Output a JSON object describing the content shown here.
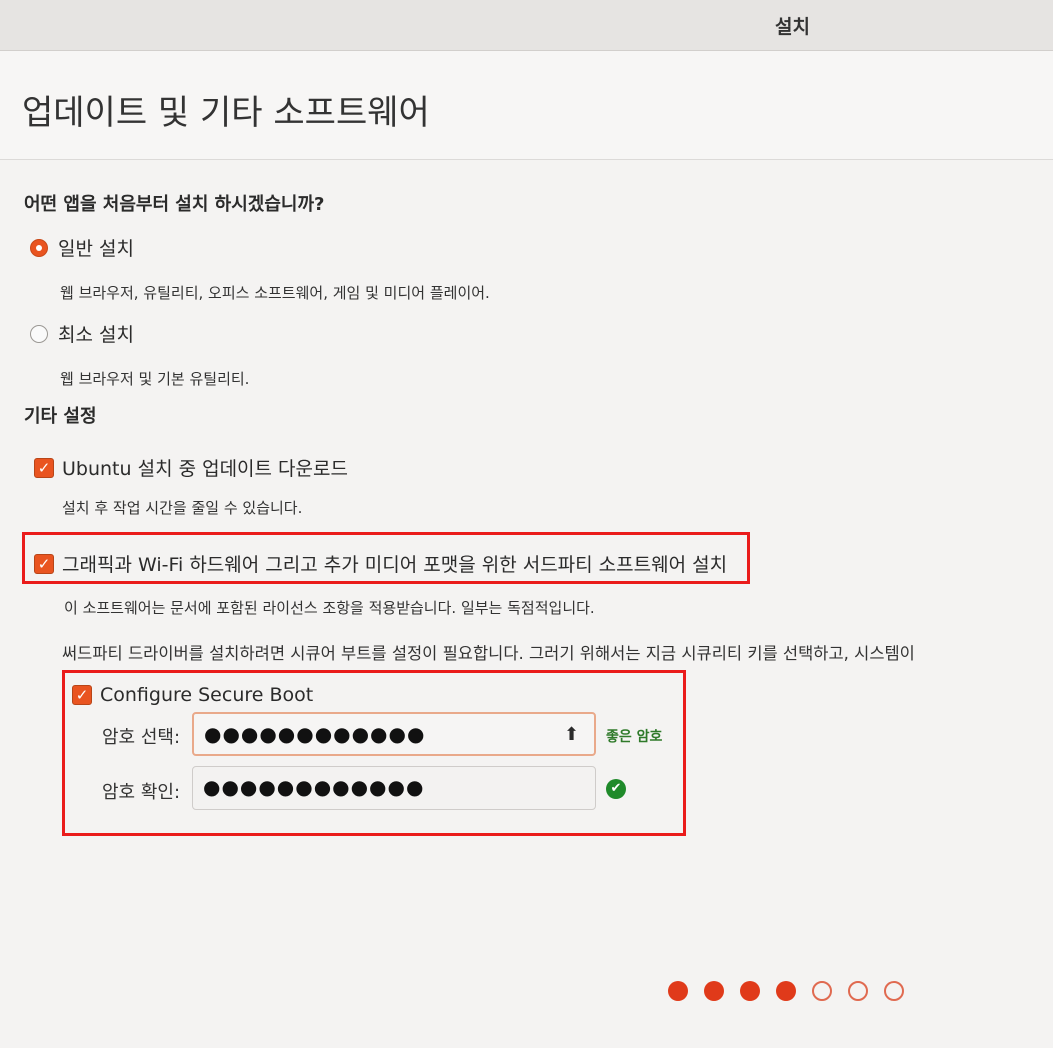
{
  "window": {
    "title": "설치"
  },
  "header": {
    "title": "업데이트 및 기타 소프트웨어"
  },
  "question": "어떤 앱을 처음부터 설치 하시겠습니까?",
  "install_options": [
    {
      "label": "일반 설치",
      "description": "웹 브라우저, 유틸리티, 오피스  소프트웨어, 게임 및 미디어 플레이어.",
      "selected": true
    },
    {
      "label": "최소 설치",
      "description": "웹 브라우저 및 기본 유틸리티.",
      "selected": false
    }
  ],
  "other_settings": {
    "title": "기타 설정",
    "download_updates": {
      "label": "Ubuntu 설치 중 업데이트 다운로드",
      "description": "설치 후 작업 시간을 줄일 수 있습니다.",
      "checked": true
    },
    "third_party": {
      "label": "그래픽과 Wi-Fi 하드웨어 그리고 추가 미디어 포맷을 위한 서드파티 소프트웨어 설치",
      "description": "이 소프트웨어는 문서에 포함된 라이선스 조항을 적용받습니다. 일부는 독점적입니다.",
      "checked": true
    },
    "secure_boot_notice": "써드파티 드라이버를 설치하려면 시큐어 부트를 설정이 필요합니다. 그러기 위해서는 지금 시큐리티 키를 선택하고, 시스템이"
  },
  "secure_boot": {
    "label": "Configure Secure Boot",
    "checked": true,
    "password_label": "암호 선택:",
    "password_value": "●●●●●●●●●●●●",
    "confirm_label": "암호 확인:",
    "confirm_value": "●●●●●●●●●●●●",
    "strength": "좋은 암호",
    "caps_icon": "⬆",
    "ok_icon": "✔"
  },
  "progress": {
    "total_steps": 7,
    "completed_steps": 4
  },
  "colors": {
    "accent": "#e95420",
    "annotation": "#ea1b1b",
    "success": "#1f8a2a"
  }
}
